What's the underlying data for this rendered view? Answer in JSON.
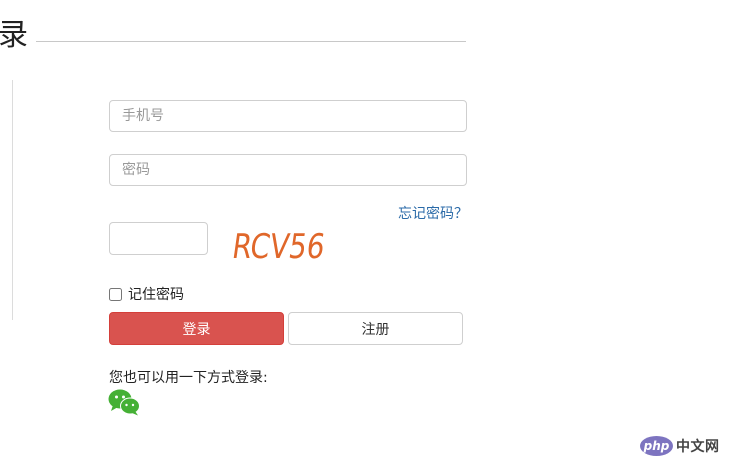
{
  "page": {
    "title": "录"
  },
  "form": {
    "phone_placeholder": "手机号",
    "password_placeholder": "密码",
    "forgot_label": "忘记密码？",
    "captcha_value": "",
    "captcha_text": "RCV56",
    "remember_label": "记住密码",
    "remember_checked": false,
    "login_label": "登录",
    "register_label": "注册"
  },
  "social": {
    "prompt": "您也可以用一下方式登录:",
    "icon": "wechat-icon",
    "accent_color": "#45b035"
  },
  "colors": {
    "login_button": "#d9534f",
    "link": "#2a6aa8",
    "captcha": "#e0672a"
  },
  "watermark": {
    "logo_text": "php",
    "site_text": "中文网"
  }
}
